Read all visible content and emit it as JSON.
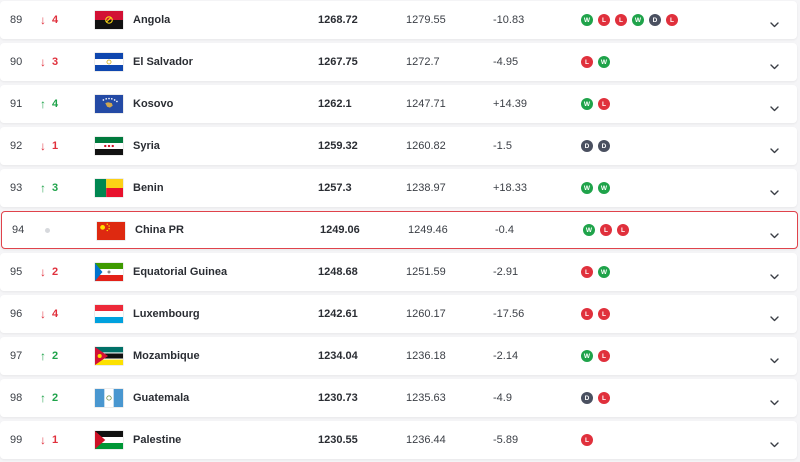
{
  "rows": [
    {
      "rank": "89",
      "dir": "down",
      "change": "4",
      "country": "Angola",
      "flag": "angola",
      "points": "1268.72",
      "prev": "1279.55",
      "diff": "-10.83",
      "form": [
        "W",
        "L",
        "L",
        "W",
        "D",
        "L"
      ]
    },
    {
      "rank": "90",
      "dir": "down",
      "change": "3",
      "country": "El Salvador",
      "flag": "el-salvador",
      "points": "1267.75",
      "prev": "1272.7",
      "diff": "-4.95",
      "form": [
        "L",
        "W"
      ]
    },
    {
      "rank": "91",
      "dir": "up",
      "change": "4",
      "country": "Kosovo",
      "flag": "kosovo",
      "points": "1262.1",
      "prev": "1247.71",
      "diff": "+14.39",
      "form": [
        "W",
        "L"
      ]
    },
    {
      "rank": "92",
      "dir": "down",
      "change": "1",
      "country": "Syria",
      "flag": "syria",
      "points": "1259.32",
      "prev": "1260.82",
      "diff": "-1.5",
      "form": [
        "D",
        "D"
      ]
    },
    {
      "rank": "93",
      "dir": "up",
      "change": "3",
      "country": "Benin",
      "flag": "benin",
      "points": "1257.3",
      "prev": "1238.97",
      "diff": "+18.33",
      "form": [
        "W",
        "W"
      ]
    },
    {
      "rank": "94",
      "dir": "same",
      "change": "",
      "country": "China PR",
      "flag": "china",
      "points": "1249.06",
      "prev": "1249.46",
      "diff": "-0.4",
      "form": [
        "W",
        "L",
        "L"
      ],
      "highlighted": true
    },
    {
      "rank": "95",
      "dir": "down",
      "change": "2",
      "country": "Equatorial Guinea",
      "flag": "equatorial-guinea",
      "points": "1248.68",
      "prev": "1251.59",
      "diff": "-2.91",
      "form": [
        "L",
        "W"
      ]
    },
    {
      "rank": "96",
      "dir": "down",
      "change": "4",
      "country": "Luxembourg",
      "flag": "luxembourg",
      "points": "1242.61",
      "prev": "1260.17",
      "diff": "-17.56",
      "form": [
        "L",
        "L"
      ]
    },
    {
      "rank": "97",
      "dir": "up",
      "change": "2",
      "country": "Mozambique",
      "flag": "mozambique",
      "points": "1234.04",
      "prev": "1236.18",
      "diff": "-2.14",
      "form": [
        "W",
        "L"
      ]
    },
    {
      "rank": "98",
      "dir": "up",
      "change": "2",
      "country": "Guatemala",
      "flag": "guatemala",
      "points": "1230.73",
      "prev": "1235.63",
      "diff": "-4.9",
      "form": [
        "D",
        "L"
      ]
    },
    {
      "rank": "99",
      "dir": "down",
      "change": "1",
      "country": "Palestine",
      "flag": "palestine",
      "points": "1230.55",
      "prev": "1236.44",
      "diff": "-5.89",
      "form": [
        "L"
      ]
    }
  ],
  "colors": {
    "win": "#1fa34a",
    "loss": "#e0303c",
    "draw": "#4a5060",
    "highlight": "#e0434b"
  },
  "icons": {
    "down": "arrow-down-icon",
    "up": "arrow-up-icon",
    "same": "no-change-dot-icon",
    "expand": "chevron-down-icon"
  }
}
